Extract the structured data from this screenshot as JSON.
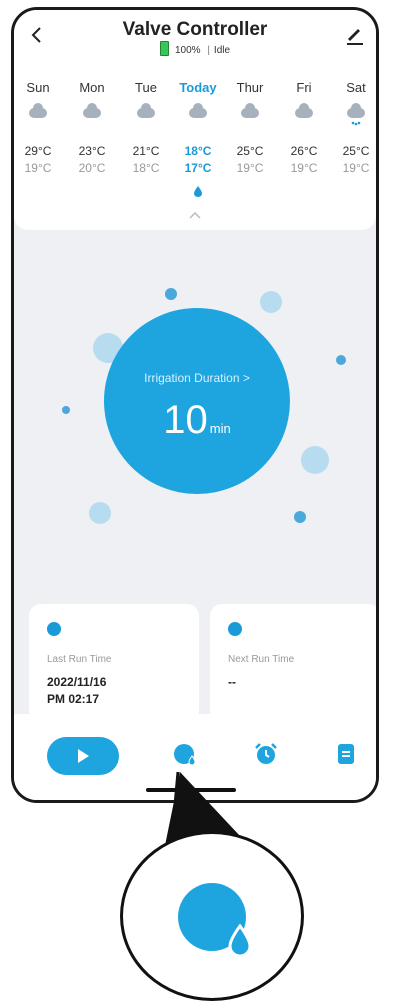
{
  "header": {
    "title": "Valve Controller",
    "battery": "100%",
    "state": "Idle",
    "back_icon": "chevron-left-icon",
    "edit_icon": "pencil-icon"
  },
  "weather": [
    {
      "day": "Sun",
      "high": "29°C",
      "low": "19°C"
    },
    {
      "day": "Mon",
      "high": "23°C",
      "low": "20°C"
    },
    {
      "day": "Tue",
      "high": "21°C",
      "low": "18°C"
    },
    {
      "day": "Today",
      "high": "18°C",
      "low": "17°C"
    },
    {
      "day": "Thur",
      "high": "25°C",
      "low": "19°C"
    },
    {
      "day": "Fri",
      "high": "26°C",
      "low": "19°C"
    },
    {
      "day": "Sat",
      "high": "25°C",
      "low": "19°C"
    }
  ],
  "duration": {
    "label": "Irrigation Duration >",
    "value": "10",
    "unit": "min"
  },
  "cards": {
    "last": {
      "label": "Last Run Time",
      "value": "2022/11/16\nPM 02:17"
    },
    "next": {
      "label": "Next Run Time",
      "value": "--"
    }
  },
  "nav": {
    "play_icon": "play-icon",
    "water_icon": "water-drop-icon",
    "alarm_icon": "alarm-clock-icon",
    "log_icon": "list-icon"
  },
  "colors": {
    "accent": "#1ea5e0",
    "battery": "#34c759"
  }
}
